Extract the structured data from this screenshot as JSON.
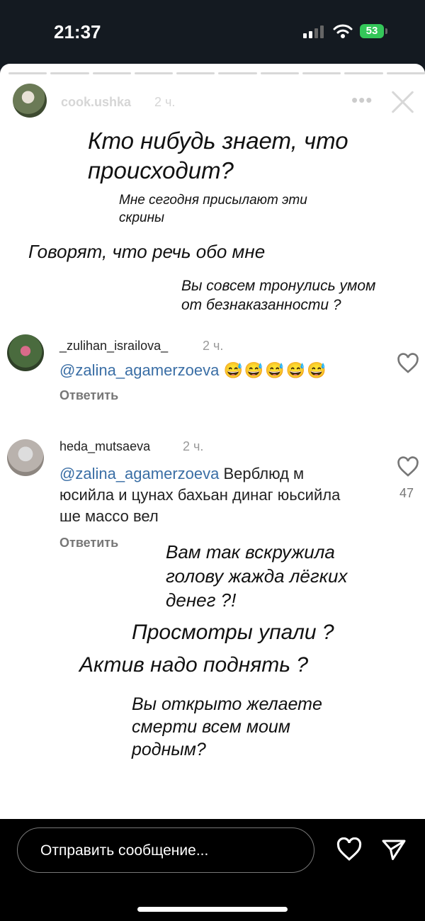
{
  "status_bar": {
    "time": "21:37",
    "battery": "53"
  },
  "story": {
    "username": "cook.ushka",
    "time": "2 ч.",
    "more": "•••",
    "notes": [
      "Кто нибудь знает, что происходит?",
      "Мне сегодня присылают эти скрины",
      "Говорят, что речь обо мне",
      "Вы совсем тронулись умом от безнаказанности ?",
      "Вам так вскружила голову  жажда лёгких денег ?!",
      "Просмотры упали ?",
      "Актив надо поднять ?",
      "Вы открыто желаете смерти всем моим родным?"
    ],
    "comments": [
      {
        "username": "_zulihan_israilova_",
        "time": "2 ч.",
        "mention": "@zalina_agamerzoeva",
        "text": "😅😅😅😅😅",
        "reply": "Ответить",
        "likes": ""
      },
      {
        "username": "heda_mutsaeva",
        "time": "2 ч.",
        "mention": "@zalina_agamerzoeva",
        "text": " Верблюд м юсийла и цунах бахьан динаг юьсийла ше массо вел",
        "reply": "Ответить",
        "likes": "47"
      }
    ]
  },
  "bottom_bar": {
    "message_placeholder": "Отправить сообщение..."
  },
  "colors": {
    "mention": "#3a6ea5",
    "battery": "#34c759"
  },
  "icons": [
    "signal-icon",
    "wifi-icon",
    "battery-icon",
    "close-icon",
    "heart-icon",
    "send-icon"
  ]
}
